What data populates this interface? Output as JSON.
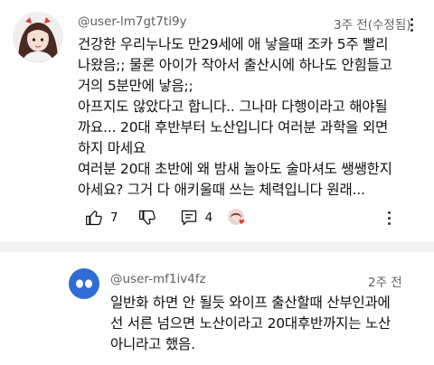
{
  "comment1": {
    "username": "@user-lm7gt7ti9y",
    "timestamp": "3주 전(수정됨)",
    "text": "건강한 우리누나도 만29세에 애 낳을때 조카 5주 빨리\n나왔음;; 물론 아이가 작아서 출산시에 하나도 안힘들고\n거의 5분만에 낳음;;\n아프지도 않았다고 합니다.. 그나마 다행이라고 해야될\n까요... 20대 후반부터 노산입니다 여러분 과학을 외면\n하지 마세요\n여러분 20대 초반에 왜 밤새 놀아도 술마셔도 쌩쌩한지\n아세요? 그거 다 애키울때 쓰는 체력입니다 원래...",
    "likes": "7",
    "replies": "4",
    "avatar_icon": "user-photo-avatar",
    "creator_heart_icon": "creator-heart-avatar"
  },
  "comment2": {
    "username": "@user-mf1iv4fz",
    "timestamp": "2주 전",
    "text": "일반화 하면 안 될듯 와이프 출산할때 산부인과에\n선 서른 넘으면 노산이라고 20대후반까지는 노산\n아니라고 했음.",
    "avatar_color": "#2f6dd6",
    "avatar_icon": "default-eyes-avatar"
  },
  "colors": {
    "meta": "#606060",
    "text": "#0f0f0f",
    "band": "#f2f2f2"
  }
}
